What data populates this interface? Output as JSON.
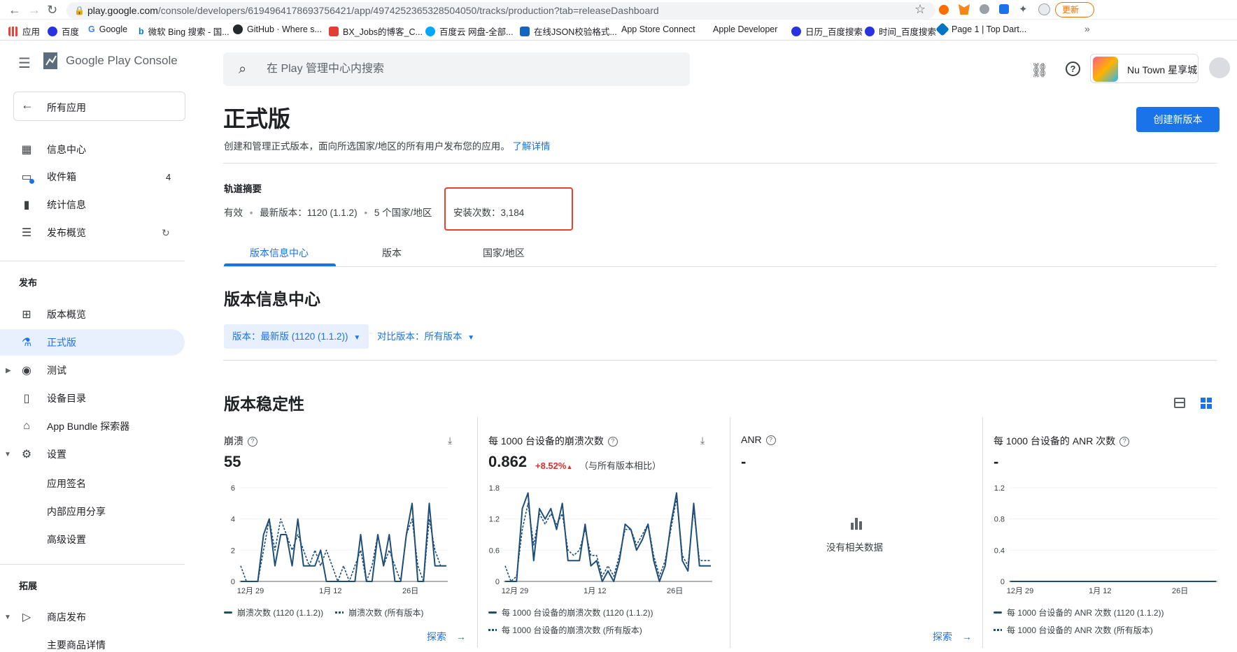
{
  "browser": {
    "url_host": "play.google.com",
    "url_path": "/console/developers/6194964178693756421/app/4974252365328504050/tracks/production?tab=releaseDashboard",
    "update_label": "更新",
    "bookmarks": [
      "应用",
      "百度",
      "Google",
      "微软 Bing 搜索 - 国...",
      "GitHub · Where s...",
      "BX_Jobs的博客_C...",
      "百度云 网盘-全部...",
      "在线JSON校验格式...",
      "App Store Connect",
      "Apple Developer",
      "日历_百度搜索",
      "时间_百度搜索",
      "Page 1 | Top Dart..."
    ]
  },
  "app": {
    "brand": "Google Play Console",
    "search_placeholder": "在 Play 管理中心内搜索",
    "app_name": "Nu Town 星享城"
  },
  "sidebar": {
    "back_label": "所有应用",
    "items_top": [
      {
        "label": "信息中心",
        "icon": "dashboard-icon"
      },
      {
        "label": "收件箱",
        "icon": "inbox-icon",
        "badge": "4"
      },
      {
        "label": "统计信息",
        "icon": "bar-chart-icon"
      },
      {
        "label": "发布概览",
        "icon": "publish-overview-icon"
      }
    ],
    "section_release": "发布",
    "items_release": [
      {
        "label": "版本概览",
        "icon": "grid-icon"
      },
      {
        "label": "正式版",
        "icon": "flask-icon"
      },
      {
        "label": "测试",
        "icon": "play-circle-icon"
      },
      {
        "label": "设备目录",
        "icon": "devices-icon"
      },
      {
        "label": "App Bundle 探索器",
        "icon": "android-icon"
      },
      {
        "label": "设置",
        "icon": "gear-icon"
      }
    ],
    "settings_sub": [
      "应用签名",
      "内部应用分享",
      "高级设置"
    ],
    "section_grow": "拓展",
    "items_grow": [
      {
        "label": "商店发布",
        "icon": "store-play-icon"
      }
    ],
    "grow_sub": [
      "主要商品详情"
    ]
  },
  "page": {
    "title": "正式版",
    "subtitle": "创建和管理正式版本，面向所选国家/地区的所有用户发布您的应用。",
    "learn_more": "了解详情",
    "create_button": "创建新版本",
    "track_summary_heading": "轨道摘要",
    "status": "有效",
    "latest_version": "最新版本：1120 (1.1.2)",
    "countries": "5 个国家/地区",
    "installs": "安装次数：3,184",
    "tabs": [
      "版本信息中心",
      "版本",
      "国家/地区"
    ],
    "section_title": "版本信息中心",
    "version_filter": "版本：最新版 (1120 (1.1.2))",
    "compare_filter": "对比版本：所有版本",
    "stability_title": "版本稳定性",
    "explore": "探索",
    "no_data": "没有相关数据",
    "compare_note": "（与所有版本相比）",
    "delta": "+8.52%"
  },
  "chart_data": [
    {
      "type": "line",
      "title": "崩溃",
      "value": "55",
      "x_ticks": [
        "12月 29",
        "1月 12",
        "26日"
      ],
      "y_ticks": [
        "0",
        "2",
        "4",
        "6"
      ],
      "ylim": [
        0,
        6
      ],
      "series": [
        {
          "name": "崩溃次数 (1120 (1.1.2))",
          "style": "solid",
          "values": [
            0,
            0,
            0,
            0,
            3,
            4,
            1,
            3,
            3,
            1,
            4,
            1,
            1,
            1,
            2,
            0,
            0,
            0,
            0,
            0,
            0,
            3,
            0,
            0,
            3,
            1,
            3,
            0,
            0,
            3,
            5,
            0,
            0,
            5,
            1,
            1,
            1
          ]
        },
        {
          "name": "崩溃次数 (所有版本)",
          "style": "dotted",
          "values": [
            1,
            0,
            0,
            0,
            2,
            4,
            2,
            4,
            3,
            2,
            3,
            2,
            1,
            2,
            1,
            2,
            1,
            0,
            1,
            0,
            1,
            2,
            0,
            1,
            3,
            1,
            2,
            1,
            0,
            3,
            4,
            1,
            0,
            4,
            2,
            1,
            1
          ]
        }
      ]
    },
    {
      "type": "line",
      "title": "每 1000 台设备的崩溃次数",
      "value": "0.862",
      "x_ticks": [
        "12月 29",
        "1月 12",
        "26日"
      ],
      "y_ticks": [
        "0",
        "0.6",
        "1.2",
        "1.8"
      ],
      "ylim": [
        0,
        1.8
      ],
      "series": [
        {
          "name": "每 1000 台设备的崩溃次数 (1120 (1.1.2))",
          "style": "solid",
          "values": [
            0,
            0,
            0,
            1.4,
            1.7,
            0.4,
            1.4,
            1.2,
            1.4,
            1.0,
            1.5,
            0.4,
            0.4,
            0.4,
            1.1,
            0.3,
            0.4,
            0,
            0.2,
            0,
            0.4,
            1.1,
            1.0,
            0.6,
            0.8,
            1.1,
            0.4,
            0,
            0.3,
            1.1,
            1.7,
            0.4,
            0.2,
            1.5,
            0.3,
            0.3,
            0.3
          ]
        },
        {
          "name": "每 1000 台设备的崩溃次数 (所有版本)",
          "style": "dotted",
          "values": [
            0.3,
            0,
            0.1,
            1.0,
            1.5,
            0.7,
            1.3,
            1.1,
            1.3,
            1.1,
            1.3,
            0.6,
            0.5,
            0.6,
            1.0,
            0.5,
            0.5,
            0.1,
            0.3,
            0.1,
            0.5,
            1.0,
            1.0,
            0.7,
            0.9,
            1.1,
            0.5,
            0.1,
            0.4,
            1.0,
            1.6,
            0.5,
            0.3,
            1.4,
            0.4,
            0.4,
            0.4
          ]
        }
      ]
    },
    {
      "type": "line",
      "title": "ANR",
      "value": "-",
      "series": []
    },
    {
      "type": "line",
      "title": "每 1000 台设备的 ANR 次数",
      "value": "-",
      "x_ticks": [
        "12月 29",
        "1月 12",
        "26日"
      ],
      "y_ticks": [
        "0",
        "0.4",
        "0.8",
        "1.2"
      ],
      "ylim": [
        0,
        1.2
      ],
      "series": [
        {
          "name": "每 1000 台设备的 ANR 次数 (1120 (1.1.2))",
          "style": "solid",
          "values": [
            0,
            0,
            0,
            0,
            0,
            0,
            0,
            0,
            0,
            0,
            0,
            0,
            0,
            0,
            0,
            0,
            0,
            0,
            0,
            0,
            0,
            0,
            0,
            0,
            0,
            0,
            0,
            0,
            0,
            0,
            0,
            0,
            0,
            0,
            0,
            0,
            0
          ]
        },
        {
          "name": "每 1000 台设备的 ANR 次数 (所有版本)",
          "style": "dotted",
          "values": [
            0,
            0,
            0,
            0,
            0,
            0,
            0,
            0,
            0,
            0,
            0,
            0,
            0,
            0,
            0,
            0,
            0,
            0,
            0,
            0,
            0,
            0,
            0,
            0,
            0,
            0,
            0,
            0,
            0,
            0,
            0,
            0,
            0,
            0,
            0,
            0,
            0
          ]
        }
      ]
    }
  ]
}
